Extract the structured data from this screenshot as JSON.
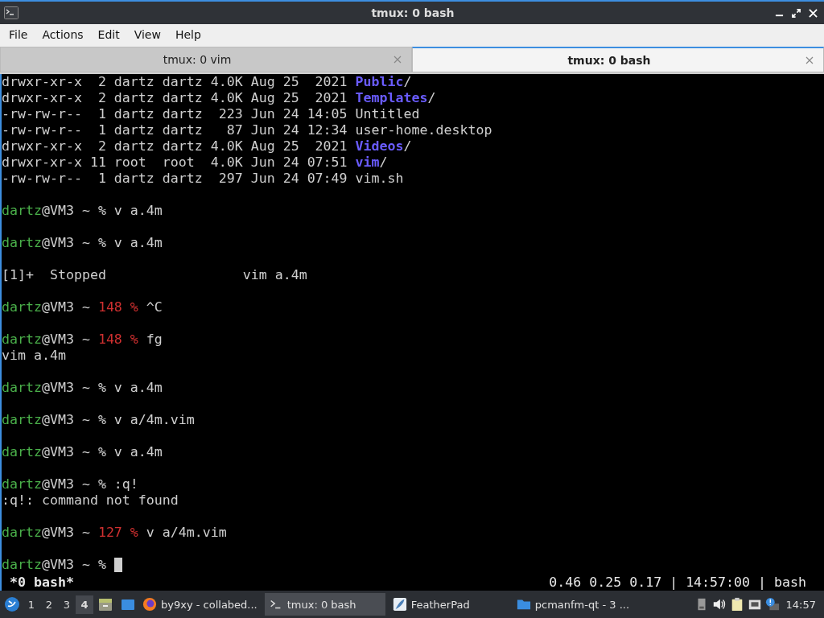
{
  "window": {
    "title": "tmux: 0 bash"
  },
  "menu": [
    "File",
    "Actions",
    "Edit",
    "View",
    "Help"
  ],
  "tabs": [
    {
      "label": "tmux: 0 vim",
      "selected": false
    },
    {
      "label": "tmux: 0 bash",
      "selected": true
    }
  ],
  "terminal": {
    "lines": [
      {
        "segments": [
          {
            "kind": "plain",
            "text": "drwxr-xr-x  2 dartz dartz 4.0K Aug 25  2021 "
          },
          {
            "kind": "dir",
            "text": "Public"
          },
          {
            "kind": "plain",
            "text": "/"
          }
        ]
      },
      {
        "segments": [
          {
            "kind": "plain",
            "text": "drwxr-xr-x  2 dartz dartz 4.0K Aug 25  2021 "
          },
          {
            "kind": "dir",
            "text": "Templates"
          },
          {
            "kind": "plain",
            "text": "/"
          }
        ]
      },
      {
        "segments": [
          {
            "kind": "plain",
            "text": "-rw-rw-r--  1 dartz dartz  223 Jun 24 14:05 Untitled"
          }
        ]
      },
      {
        "segments": [
          {
            "kind": "plain",
            "text": "-rw-rw-r--  1 dartz dartz   87 Jun 24 12:34 user-home.desktop"
          }
        ]
      },
      {
        "segments": [
          {
            "kind": "plain",
            "text": "drwxr-xr-x  2 dartz dartz 4.0K Aug 25  2021 "
          },
          {
            "kind": "dir",
            "text": "Videos"
          },
          {
            "kind": "plain",
            "text": "/"
          }
        ]
      },
      {
        "segments": [
          {
            "kind": "plain",
            "text": "drwxr-xr-x 11 root  root  4.0K Jun 24 07:51 "
          },
          {
            "kind": "dir",
            "text": "vim"
          },
          {
            "kind": "plain",
            "text": "/"
          }
        ]
      },
      {
        "segments": [
          {
            "kind": "plain",
            "text": "-rw-rw-r--  1 dartz dartz  297 Jun 24 07:49 vim.sh"
          }
        ]
      },
      {
        "space_before": true,
        "segments": [
          {
            "kind": "user",
            "text": "dartz"
          },
          {
            "kind": "plain",
            "text": "@VM3 ~ % v a.4m"
          }
        ]
      },
      {
        "space_before": true,
        "segments": [
          {
            "kind": "user",
            "text": "dartz"
          },
          {
            "kind": "plain",
            "text": "@VM3 ~ % v a.4m"
          }
        ]
      },
      {
        "space_before": true,
        "segments": [
          {
            "kind": "plain",
            "text": "[1]+  Stopped                 vim a.4m"
          }
        ]
      },
      {
        "space_before": true,
        "segments": [
          {
            "kind": "user",
            "text": "dartz"
          },
          {
            "kind": "plain",
            "text": "@VM3 ~ "
          },
          {
            "kind": "error",
            "text": "148 %"
          },
          {
            "kind": "plain",
            "text": " ^C"
          }
        ]
      },
      {
        "space_before": true,
        "segments": [
          {
            "kind": "user",
            "text": "dartz"
          },
          {
            "kind": "plain",
            "text": "@VM3 ~ "
          },
          {
            "kind": "error",
            "text": "148 %"
          },
          {
            "kind": "plain",
            "text": " fg"
          }
        ]
      },
      {
        "segments": [
          {
            "kind": "plain",
            "text": "vim a.4m"
          }
        ]
      },
      {
        "space_before": true,
        "segments": [
          {
            "kind": "user",
            "text": "dartz"
          },
          {
            "kind": "plain",
            "text": "@VM3 ~ % v a.4m"
          }
        ]
      },
      {
        "space_before": true,
        "segments": [
          {
            "kind": "user",
            "text": "dartz"
          },
          {
            "kind": "plain",
            "text": "@VM3 ~ % v a/4m.vim"
          }
        ]
      },
      {
        "space_before": true,
        "segments": [
          {
            "kind": "user",
            "text": "dartz"
          },
          {
            "kind": "plain",
            "text": "@VM3 ~ % v a.4m"
          }
        ]
      },
      {
        "space_before": true,
        "segments": [
          {
            "kind": "user",
            "text": "dartz"
          },
          {
            "kind": "plain",
            "text": "@VM3 ~ % :q!"
          }
        ]
      },
      {
        "segments": [
          {
            "kind": "plain",
            "text": ":q!: command not found"
          }
        ]
      },
      {
        "space_before": true,
        "segments": [
          {
            "kind": "user",
            "text": "dartz"
          },
          {
            "kind": "plain",
            "text": "@VM3 ~ "
          },
          {
            "kind": "error",
            "text": "127 %"
          },
          {
            "kind": "plain",
            "text": " v a/4m.vim"
          }
        ]
      },
      {
        "space_before": true,
        "segments": [
          {
            "kind": "user",
            "text": "dartz"
          },
          {
            "kind": "plain",
            "text": "@VM3 ~ % "
          }
        ],
        "cursor": true
      }
    ]
  },
  "tmux_status": {
    "window": "*0 bash*",
    "right": "0.46 0.25 0.17 | 14:57:00 | bash"
  },
  "taskbar": {
    "workspaces": [
      {
        "label": "1",
        "selected": false
      },
      {
        "label": "2",
        "selected": false
      },
      {
        "label": "3",
        "selected": false
      },
      {
        "label": "4",
        "selected": true
      }
    ],
    "tasks": [
      {
        "kind": "browser",
        "label": "by9xy - collabed...",
        "selected": false
      },
      {
        "kind": "terminal",
        "label": "tmux: 0 bash",
        "selected": true
      },
      {
        "kind": "editor",
        "label": "FeatherPad",
        "selected": false
      },
      {
        "kind": "folder",
        "label": "pcmanfm-qt - 3 ...",
        "selected": false
      }
    ],
    "clock": "14:57"
  }
}
